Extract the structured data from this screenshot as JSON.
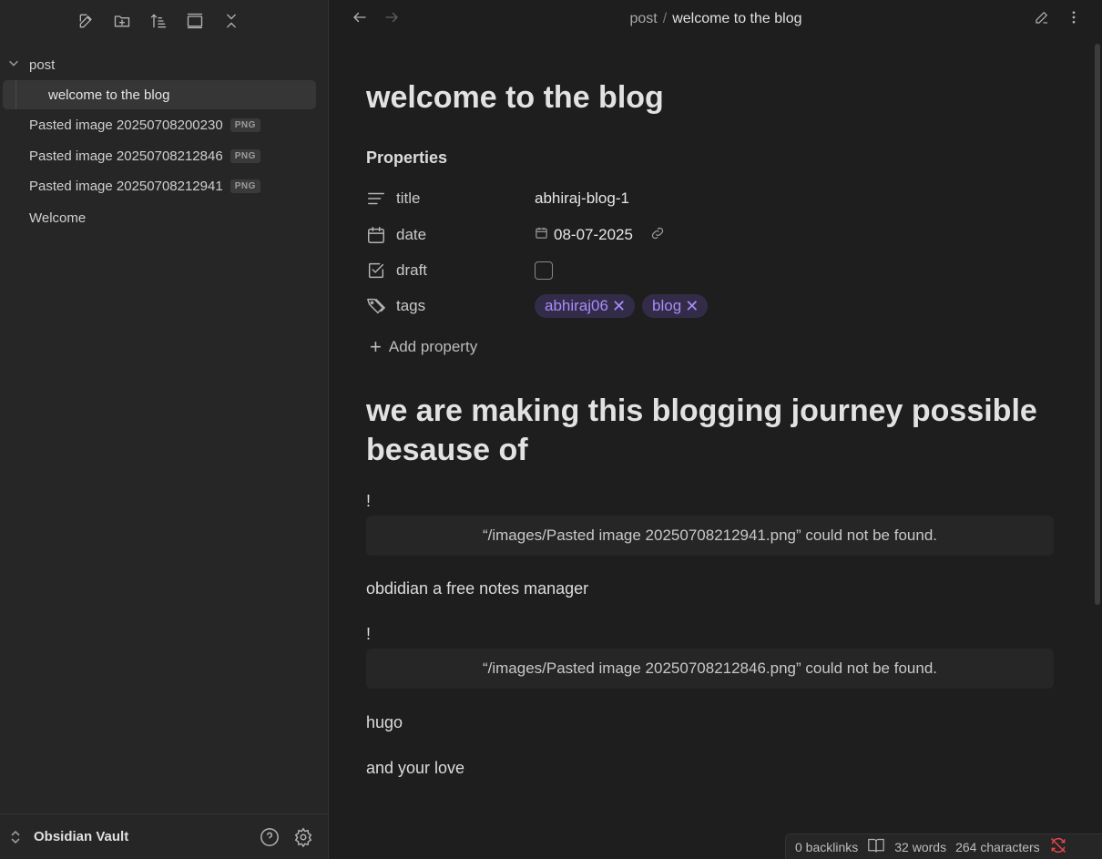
{
  "sidebar": {
    "toolbar": [
      "new-note",
      "new-folder",
      "sort",
      "auto-reveal",
      "collapse-all"
    ],
    "folder": {
      "name": "post"
    },
    "items": [
      {
        "label": "welcome to the blog",
        "active": true
      },
      {
        "label": "Pasted image 20250708200230",
        "badge": "PNG"
      },
      {
        "label": "Pasted image 20250708212846",
        "badge": "PNG"
      },
      {
        "label": "Pasted image 20250708212941",
        "badge": "PNG"
      },
      {
        "label": "Welcome"
      }
    ],
    "footer": {
      "vault_name": "Obsidian Vault"
    }
  },
  "header": {
    "breadcrumb_parent": "post",
    "breadcrumb_sep": "/",
    "breadcrumb_current": "welcome to the blog"
  },
  "note": {
    "title": "welcome to the blog",
    "properties_heading": "Properties",
    "properties": {
      "title": {
        "key": "title",
        "value": "abhiraj-blog-1"
      },
      "date": {
        "key": "date",
        "value": "08-07-2025"
      },
      "draft": {
        "key": "draft",
        "checked": false
      },
      "tags": {
        "key": "tags",
        "values": [
          "abhiraj06",
          "blog"
        ]
      }
    },
    "add_property": "Add property",
    "heading": "we are making this blogging journey possible besause of",
    "body": [
      {
        "text": "!"
      },
      {
        "embed_error": "“/images/Pasted image 20250708212941.png” could not be found."
      },
      {
        "text": "obdidian a free notes manager"
      },
      {
        "text": "!"
      },
      {
        "embed_error": "“/images/Pasted image 20250708212846.png” could not be found."
      },
      {
        "text": "hugo"
      },
      {
        "text": "and your love"
      }
    ]
  },
  "status_bar": {
    "backlinks": "0 backlinks",
    "words": "32 words",
    "characters": "264 characters"
  },
  "colors": {
    "accent_tag_bg": "#332c48",
    "accent_tag_text": "#a88bfa",
    "sync_error": "#e5484d"
  }
}
